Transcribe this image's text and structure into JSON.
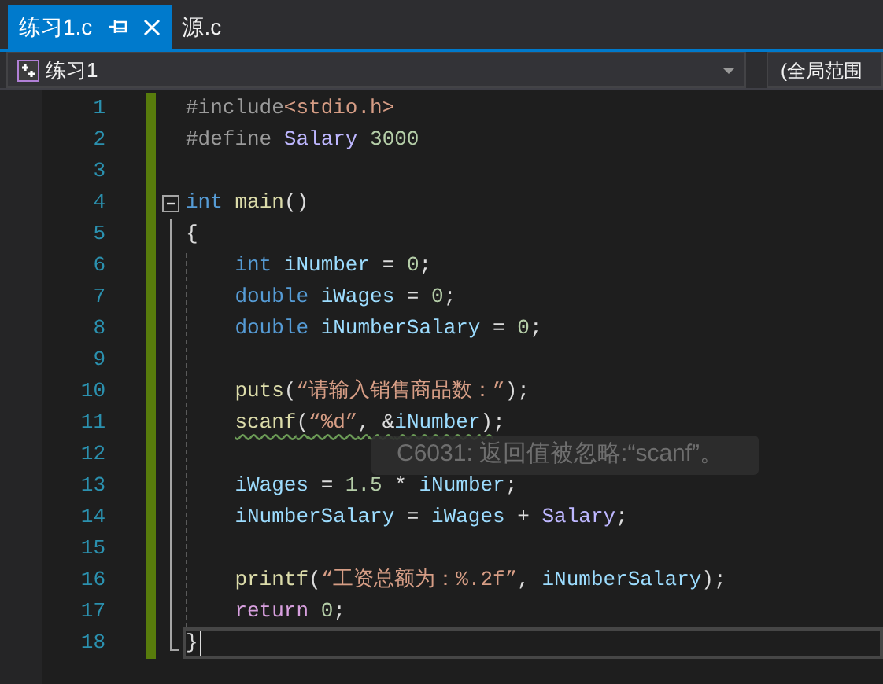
{
  "tabs": [
    {
      "label": "练习1.c",
      "selected": true,
      "pinned": true
    },
    {
      "label": "源.c",
      "selected": false,
      "pinned": false
    }
  ],
  "navigation": {
    "project": "练习1",
    "scope": "(全局范围"
  },
  "lines": [
    {
      "number": "1",
      "modified": true,
      "current": false,
      "tokens": [
        {
          "text": "#include",
          "kind": "preproc"
        },
        {
          "text": "<stdio.h>",
          "kind": "string"
        }
      ]
    },
    {
      "number": "2",
      "modified": true,
      "current": false,
      "tokens": [
        {
          "text": "#define ",
          "kind": "preproc"
        },
        {
          "text": "Salary ",
          "kind": "macro"
        },
        {
          "text": "3000",
          "kind": "number"
        }
      ]
    },
    {
      "number": "3",
      "modified": true,
      "current": false
    },
    {
      "number": "4",
      "modified": true,
      "current": false,
      "expanded": true,
      "tokens": [
        {
          "text": "int ",
          "kind": "keyword"
        },
        {
          "text": "main",
          "kind": "function"
        },
        {
          "text": "()",
          "kind": "plain"
        }
      ],
      "children": [
        {
          "number": "5",
          "modified": true,
          "current": false,
          "tokens": [
            {
              "text": "{",
              "kind": "plain"
            }
          ]
        },
        {
          "number": "6",
          "modified": true,
          "current": false,
          "tokens": [
            {
              "text": "int ",
              "kind": "keyword"
            },
            {
              "text": "iNumber ",
              "kind": "variable"
            },
            {
              "text": "= ",
              "kind": "plain"
            },
            {
              "text": "0",
              "kind": "number"
            },
            {
              "text": ";",
              "kind": "plain"
            }
          ]
        },
        {
          "number": "7",
          "modified": true,
          "current": false,
          "tokens": [
            {
              "text": "double ",
              "kind": "keyword"
            },
            {
              "text": "iWages ",
              "kind": "variable"
            },
            {
              "text": "= ",
              "kind": "plain"
            },
            {
              "text": "0",
              "kind": "number"
            },
            {
              "text": ";",
              "kind": "plain"
            }
          ]
        },
        {
          "number": "8",
          "modified": true,
          "current": false,
          "tokens": [
            {
              "text": "double ",
              "kind": "keyword"
            },
            {
              "text": "iNumberSalary ",
              "kind": "variable"
            },
            {
              "text": "= ",
              "kind": "plain"
            },
            {
              "text": "0",
              "kind": "number"
            },
            {
              "text": ";",
              "kind": "plain"
            }
          ]
        },
        {
          "number": "9",
          "modified": true,
          "current": false
        },
        {
          "number": "10",
          "modified": true,
          "current": false,
          "tokens": [
            {
              "text": "puts",
              "kind": "function"
            },
            {
              "text": "(",
              "kind": "plain"
            },
            {
              "text": "“请输入销售商品数：”",
              "kind": "string"
            },
            {
              "text": ");",
              "kind": "plain"
            }
          ]
        },
        {
          "number": "11",
          "modified": true,
          "current": false,
          "tokens": [
            {
              "text": "scanf",
              "kind": "function",
              "squiggle": true
            },
            {
              "text": "(",
              "kind": "plain",
              "squiggle": true
            },
            {
              "text": "“%d”",
              "kind": "string",
              "squiggle": true
            },
            {
              "text": ", &",
              "kind": "plain",
              "squiggle": true
            },
            {
              "text": "iNumber",
              "kind": "variable",
              "squiggle": true
            },
            {
              "text": ")",
              "kind": "plain",
              "squiggle": true
            },
            {
              "text": ";",
              "kind": "plain",
              "squiggle": false
            }
          ]
        },
        {
          "number": "12",
          "modified": true,
          "current": false
        },
        {
          "number": "13",
          "modified": true,
          "current": false,
          "tokens": [
            {
              "text": "iWages ",
              "kind": "variable"
            },
            {
              "text": "= ",
              "kind": "plain"
            },
            {
              "text": "1.5 ",
              "kind": "number"
            },
            {
              "text": "* ",
              "kind": "plain"
            },
            {
              "text": "iNumber",
              "kind": "variable"
            },
            {
              "text": ";",
              "kind": "plain"
            }
          ]
        },
        {
          "number": "14",
          "modified": true,
          "current": false,
          "tokens": [
            {
              "text": "iNumberSalary ",
              "kind": "variable"
            },
            {
              "text": "= ",
              "kind": "plain"
            },
            {
              "text": "iWages ",
              "kind": "variable"
            },
            {
              "text": "+ ",
              "kind": "plain"
            },
            {
              "text": "Salary",
              "kind": "macro"
            },
            {
              "text": ";",
              "kind": "plain"
            }
          ]
        },
        {
          "number": "15",
          "modified": true,
          "current": false
        },
        {
          "number": "16",
          "modified": true,
          "current": false,
          "tokens": [
            {
              "text": "printf",
              "kind": "function"
            },
            {
              "text": "(",
              "kind": "plain"
            },
            {
              "text": "“工资总额为：%.2f”",
              "kind": "string"
            },
            {
              "text": ", ",
              "kind": "plain"
            },
            {
              "text": "iNumberSalary",
              "kind": "variable"
            },
            {
              "text": ");",
              "kind": "plain"
            }
          ]
        },
        {
          "number": "17",
          "modified": true,
          "current": false,
          "tokens": [
            {
              "text": "return ",
              "kind": "control"
            },
            {
              "text": "0",
              "kind": "number"
            },
            {
              "text": ";",
              "kind": "plain"
            }
          ]
        },
        {
          "number": "18",
          "modified": true,
          "current": true,
          "tokens": [
            {
              "text": "}",
              "kind": "plain"
            }
          ]
        }
      ]
    }
  ],
  "tooltip": {
    "text": "C6031: 返回值被忽略:“scanf”。"
  }
}
